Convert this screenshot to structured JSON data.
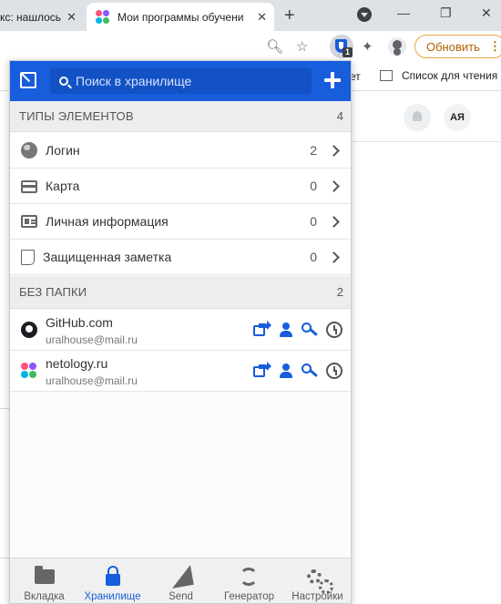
{
  "browser": {
    "tabs": [
      {
        "title": "кс: нашлось",
        "active": false
      },
      {
        "title": "Мои программы обучени",
        "active": true
      }
    ],
    "new_tab": "+",
    "tab_close": "✕",
    "window_controls": {
      "minimize": "—",
      "restore": "❐",
      "close": "✕"
    },
    "toolbar": {
      "zoom_icon": "magnifier-icon",
      "star_icon": "star-icon",
      "extension_badge": "1",
      "update_button": "Обновить",
      "update_menu": "⋮"
    },
    "bookmarks_bar": {
      "partial_text": "ет",
      "reading_list": "Список для чтения"
    }
  },
  "page": {
    "avatar_initials": "АЯ"
  },
  "bitwarden": {
    "search": {
      "placeholder": "Поиск в хранилище",
      "value": ""
    },
    "types_section": {
      "label": "ТИПЫ ЭЛЕМЕНТОВ",
      "count": "4",
      "items": [
        {
          "name": "Логин",
          "count": "2",
          "icon": "globe-icon"
        },
        {
          "name": "Карта",
          "count": "0",
          "icon": "card-icon"
        },
        {
          "name": "Личная информация",
          "count": "0",
          "icon": "id-card-icon"
        },
        {
          "name": "Защищенная заметка",
          "count": "0",
          "icon": "note-icon"
        }
      ]
    },
    "no_folder_section": {
      "label": "БЕЗ ПАПКИ",
      "count": "2",
      "items": [
        {
          "name": "GitHub.com",
          "username": "uralhouse@mail.ru",
          "icon": "github-icon"
        },
        {
          "name": "netology.ru",
          "username": "uralhouse@mail.ru",
          "icon": "netology-icon"
        }
      ]
    },
    "nav": [
      {
        "label": "Вкладка",
        "icon": "folder-icon",
        "active": false
      },
      {
        "label": "Хранилище",
        "icon": "lock-icon",
        "active": true
      },
      {
        "label": "Send",
        "icon": "send-icon",
        "active": false
      },
      {
        "label": "Генератор",
        "icon": "refresh-icon",
        "active": false
      },
      {
        "label": "Настройки",
        "icon": "gears-icon",
        "active": false
      }
    ]
  },
  "colors": {
    "brand": "#175ddc",
    "update_accent": "#e8a33d"
  }
}
